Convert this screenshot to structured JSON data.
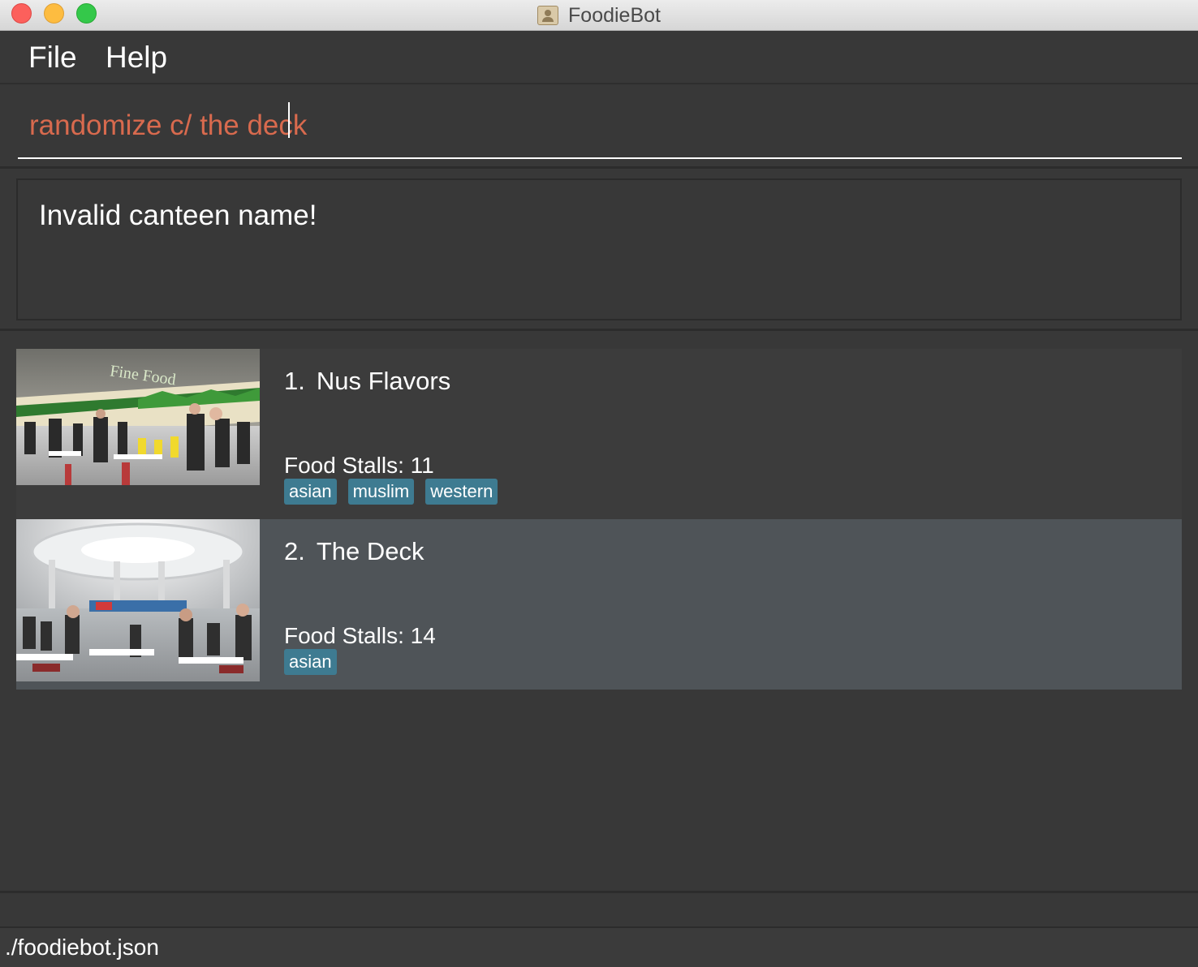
{
  "window": {
    "title": "FoodieBot"
  },
  "menu": {
    "file": "File",
    "help": "Help"
  },
  "command": {
    "value": "randomize c/ the deck"
  },
  "result": {
    "message": "Invalid canteen name!"
  },
  "canteens": [
    {
      "index": "1.",
      "name": "Nus Flavors",
      "stalls": "Food Stalls: 11",
      "tags": [
        "asian",
        "muslim",
        "western"
      ],
      "photo_sign": "Fine Food"
    },
    {
      "index": "2.",
      "name": "The Deck",
      "stalls": "Food Stalls: 14",
      "tags": [
        "asian"
      ]
    }
  ],
  "status": {
    "file_path": "./foodiebot.json"
  },
  "colors": {
    "command_text": "#d86a4e",
    "tag_bg": "#3e7b91",
    "selected_card_bg": "#4f5458",
    "background": "#383838"
  }
}
